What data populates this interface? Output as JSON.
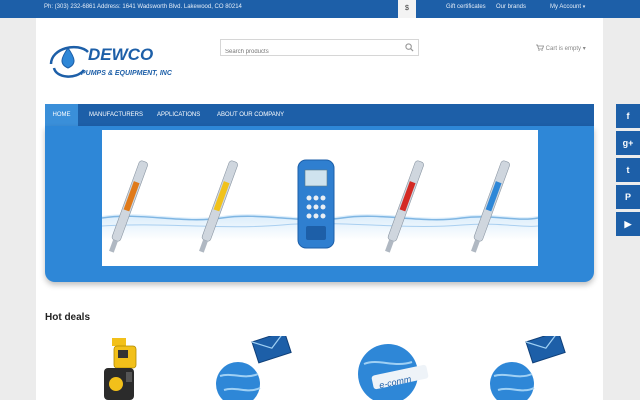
{
  "topbar": {
    "contact": "Ph: (303) 232-6861 Address: 1641 Wadsworth Blvd. Lakewood, CO 80214",
    "currency": "$",
    "gift": "Gift certificates",
    "brands": "Our brands",
    "account": "My Account",
    "caret": "▾"
  },
  "logo": {
    "name": "DEWCO",
    "tagline": "PUMPS & EQUIPMENT, INC"
  },
  "search": {
    "placeholder": "Search products"
  },
  "cart": {
    "label": "Cart is empty",
    "caret": "▾"
  },
  "nav": {
    "items": [
      {
        "label": "HOME"
      },
      {
        "label": "MANUFACTURERS"
      },
      {
        "label": "APPLICATIONS"
      },
      {
        "label": "ABOUT OUR COMPANY"
      }
    ]
  },
  "hot_deals": {
    "title": "Hot deals"
  },
  "deals": [
    {
      "image": "metering-pump"
    },
    {
      "image": "globe-envelope"
    },
    {
      "image": "e-commerce-globe",
      "text": "e-comm"
    },
    {
      "image": "globe-envelope"
    }
  ],
  "social": [
    {
      "icon": "facebook-icon",
      "glyph": "f"
    },
    {
      "icon": "google-plus-icon",
      "glyph": "g+"
    },
    {
      "icon": "twitter-icon",
      "glyph": "t"
    },
    {
      "icon": "pinterest-icon",
      "glyph": "P"
    },
    {
      "icon": "youtube-icon",
      "glyph": "▶"
    }
  ],
  "colors": {
    "brand_blue": "#1d5fa8",
    "nav_active": "#3a8fd9",
    "banner_blue": "#2e87d7",
    "page_bg": "#ececec"
  }
}
